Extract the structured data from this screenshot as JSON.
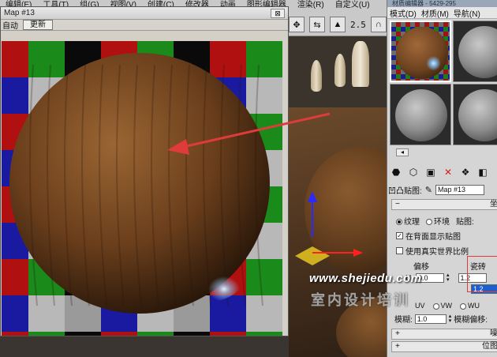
{
  "main_menu": {
    "items": [
      "编辑(E)",
      "工具(T)",
      "组(G)",
      "视图(V)",
      "创建(C)",
      "修改器",
      "动画",
      "图形编辑器",
      "渲染(R)",
      "自定义(U)"
    ]
  },
  "main_toolbar": {
    "zoom_readout": "2.5"
  },
  "map_window": {
    "title": "Map #13",
    "close_label": "⊠",
    "auto_label": "自动",
    "update_label": "更新"
  },
  "material_editor": {
    "title_partial": "材质编辑器 - 5429-295",
    "menu": [
      "模式(D)",
      "材质(M)",
      "导航(N)"
    ],
    "bump_label": "凹凸贴图:",
    "map_name": "Map #13",
    "rollout_title": "坐",
    "radio_texture": "纹理",
    "radio_env": "环境",
    "map_channel_label": "贴图:",
    "check_show_back": "在背面显示贴图",
    "check_real_world": "使用真实世界比例",
    "offset_label": "偏移",
    "tiling_label": "瓷砖",
    "u_label": "U:",
    "u_offset": "0.0",
    "u_tiling": "1.2",
    "v_tiling": "1.2",
    "uv_options": [
      "UV",
      "VW",
      "WU"
    ],
    "blur_label": "模糊:",
    "blur_value": "1.0",
    "blur_offset_label": "模糊偏移:",
    "footer1": "噪",
    "footer2": "位图"
  },
  "watermark": {
    "line1": "www.shejiedu.com",
    "line2": "室内设计培训"
  },
  "colors": {
    "red": "#b01010",
    "green": "#1a8a1a",
    "blue": "#1a1aa0",
    "annotation_red": "#e03b3b"
  }
}
